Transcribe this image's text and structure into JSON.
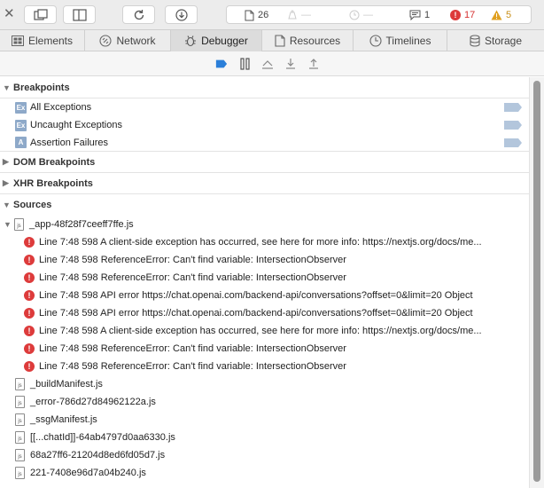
{
  "toolbar": {
    "resource_count": "26",
    "messages_count": "1",
    "errors_count": "17",
    "warnings_count": "5"
  },
  "tabs": [
    {
      "label": "Elements"
    },
    {
      "label": "Network"
    },
    {
      "label": "Debugger"
    },
    {
      "label": "Resources"
    },
    {
      "label": "Timelines"
    },
    {
      "label": "Storage"
    }
  ],
  "sections": {
    "breakpoints": "Breakpoints",
    "dom_breakpoints": "DOM Breakpoints",
    "xhr_breakpoints": "XHR Breakpoints",
    "sources": "Sources"
  },
  "breakpoints": [
    {
      "badge": "Ex",
      "label": "All Exceptions"
    },
    {
      "badge": "Ex",
      "label": "Uncaught Exceptions"
    },
    {
      "badge": "A",
      "label": "Assertion Failures"
    }
  ],
  "sources": {
    "main_file": "_app-48f28f7ceeff7ffe.js",
    "issues": [
      "Line 7:48 598 A client-side exception has occurred, see here for more info: https://nextjs.org/docs/me...",
      "Line 7:48 598 ReferenceError: Can't find variable: IntersectionObserver",
      "Line 7:48 598 ReferenceError: Can't find variable: IntersectionObserver",
      "Line 7:48 598 API error https://chat.openai.com/backend-api/conversations?offset=0&limit=20 Object",
      "Line 7:48 598 API error https://chat.openai.com/backend-api/conversations?offset=0&limit=20 Object",
      "Line 7:48 598 A client-side exception has occurred, see here for more info: https://nextjs.org/docs/me...",
      "Line 7:48 598 ReferenceError: Can't find variable: IntersectionObserver",
      "Line 7:48 598 ReferenceError: Can't find variable: IntersectionObserver"
    ],
    "files": [
      "_buildManifest.js",
      "_error-786d27d84962122a.js",
      "_ssgManifest.js",
      "[[...chatId]]-64ab4797d0aa6330.js",
      "68a27ff6-21204d8ed6fd05d7.js",
      "221-7408e96d7a04b240.js"
    ]
  },
  "colors": {
    "error": "#dd3b3b",
    "warning": "#e0a020",
    "accent": "#2b7fd9"
  }
}
